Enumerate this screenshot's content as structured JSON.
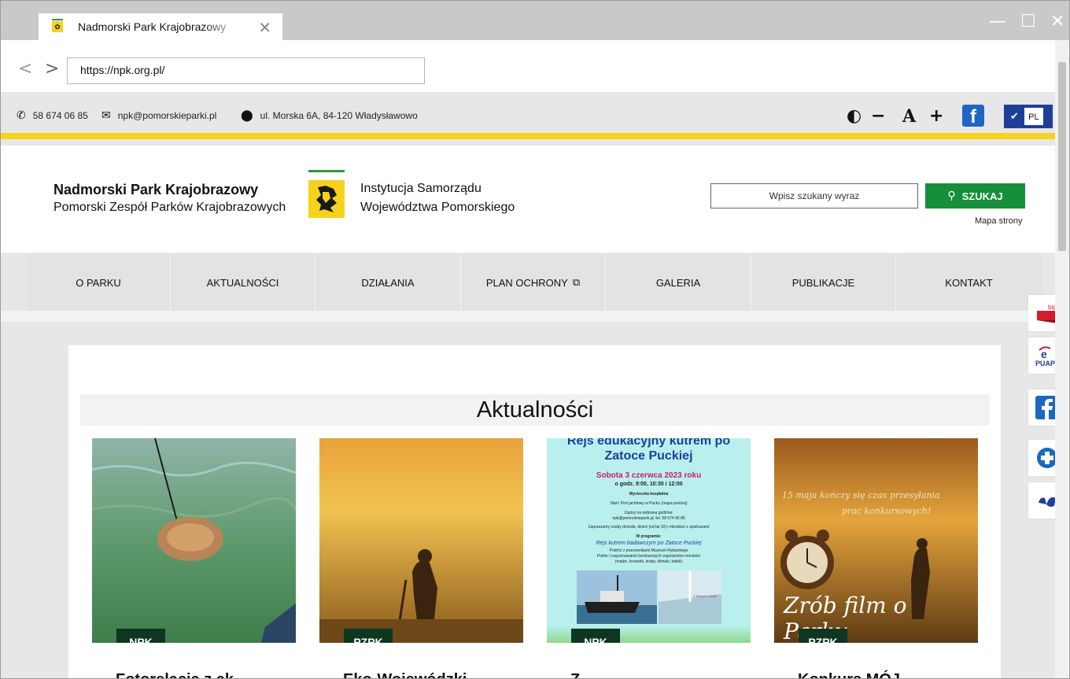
{
  "browser": {
    "tab_title": "Nadmorski Park Krajobrazowy",
    "tab_close": "✕",
    "url": "https://npk.org.pl/",
    "controls": {
      "minimize": "—",
      "maximize": "☐",
      "close": "✕"
    }
  },
  "contact": {
    "phone": "58 674 06 85",
    "email": "npk@pomorskieparki.pl",
    "address": "ul. Morska 6A, 84-120 Władysławowo"
  },
  "tools": {
    "contrast": "◐",
    "font_smaller": "−",
    "font_label": "A",
    "font_larger": "+",
    "facebook": "f",
    "language": "PL"
  },
  "header": {
    "park_name": "Nadmorski Park Krajobrazowy",
    "park_sub": "Pomorski Zespół Parków Krajobrazowych",
    "inst_line1": "Instytucja Samorządu",
    "inst_line2": "Województwa Pomorskiego",
    "search_placeholder": "Wpisz szukany wyraz",
    "search_button": "SZUKAJ",
    "sitemap": "Mapa strony"
  },
  "menu": [
    "O PARKU",
    "AKTUALNOŚCI",
    "DZIAŁANIA",
    "PLAN OCHRONY",
    "GALERIA",
    "PUBLIKACJE",
    "KONTAKT"
  ],
  "section_title": "Aktualności",
  "news": [
    {
      "tag": "NPK",
      "title": "Fotorelacja z ak"
    },
    {
      "tag": "PZPK",
      "title": "Eko-Wojewódzki"
    },
    {
      "tag": "NPK",
      "title": "Z",
      "poster": {
        "title": "Rejs edukacyjny kutrem po Zatoce Puckiej",
        "date": "Sobota 3 czerwca 2023 roku",
        "time": "o godz. 9:00, 10:30 i 12:00",
        "free": "Wycieczka bezpłatna",
        "start": "Start: Port jachtowy w Pucku (mapa poniżej)",
        "signup1": "Zapisy na wybraną godzinę:",
        "signup2": "npk@pomorskieparki.pl, tel. 58 674 06 85",
        "invite": "Zapraszamy osoby dorosłe, dzieci (od lat 10) i młodzież z opiekunami",
        "program": "W programie:",
        "prog1": "Rejs kutrem badawczym po Zatoce Puckiej",
        "prog2": "Podróż z pracownikami Muzeum Rybackiego",
        "prog3": "Połów i rozpoznawanie bentosowych organizmów morskich",
        "prog4": "(małże, krewetki, kraby, ślimaki, babki)",
        "map_label": "X Miejsce zbiórki"
      }
    },
    {
      "tag": "PZPK",
      "title": "Konkurs MÓJ",
      "overlay1": "15 maja kończy się czas przesyłania",
      "overlay2": "prac konkursowych!",
      "overlay3": "Zrób film o Parku"
    }
  ]
}
